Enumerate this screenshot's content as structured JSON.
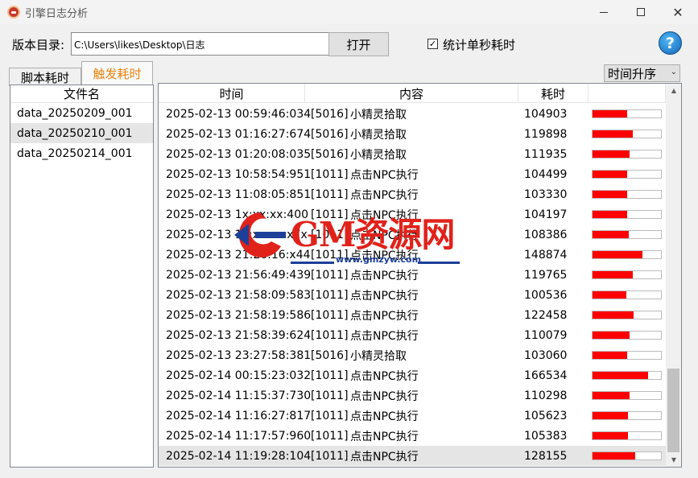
{
  "window": {
    "title": "引擎日志分析",
    "minimize_icon": "minimize-icon",
    "maximize_icon": "maximize-icon",
    "close_label": "✕"
  },
  "toolbar": {
    "dir_label": "版本目录:",
    "path_value": "C:\\Users\\likes\\Desktop\\日志",
    "open_label": "打开",
    "checkbox_checked": true,
    "checkbox_mark": "✓",
    "checkbox_label": "统计单秒耗时",
    "help_label": "?"
  },
  "tabs": [
    {
      "label": "脚本耗时",
      "active": false
    },
    {
      "label": "触发耗时",
      "active": true
    }
  ],
  "sort": {
    "selected": "时间升序"
  },
  "file_list": {
    "header": "文件名",
    "items": [
      {
        "name": "data_20250209_001",
        "selected": false
      },
      {
        "name": "data_20250210_001",
        "selected": true
      },
      {
        "name": "data_20250214_001",
        "selected": false
      }
    ]
  },
  "table": {
    "headers": [
      "时间",
      "内容",
      "耗时"
    ],
    "bar_max": 205000,
    "rows": [
      {
        "time": "2025-02-13 00:59:46:034",
        "code": "[5016]",
        "content": "小精灵拾取",
        "value": 104903
      },
      {
        "time": "2025-02-13 01:16:27:674",
        "code": "[5016]",
        "content": "小精灵拾取",
        "value": 119898
      },
      {
        "time": "2025-02-13 01:20:08:035",
        "code": "[5016]",
        "content": "小精灵拾取",
        "value": 111935
      },
      {
        "time": "2025-02-13 10:58:54:951",
        "code": "[1011]",
        "content": "点击NPC执行",
        "value": 104499
      },
      {
        "time": "2025-02-13 11:08:05:851",
        "code": "[1011]",
        "content": "点击NPC执行",
        "value": 103330
      },
      {
        "time": "2025-02-13 1x:xx:xx:400",
        "code": "[1011]",
        "content": "点击NPC执行",
        "value": 104197
      },
      {
        "time": "2025-02-13 1x:xx:xx:x7x",
        "code": "[1011]",
        "content": "点击NPC执行",
        "value": 108386
      },
      {
        "time": "2025-02-13 21:26:16:x44",
        "code": "[1011]",
        "content": "点击NPC执行",
        "value": 148874
      },
      {
        "time": "2025-02-13 21:56:49:439",
        "code": "[1011]",
        "content": "点击NPC执行",
        "value": 119765
      },
      {
        "time": "2025-02-13 21:58:09:583",
        "code": "[1011]",
        "content": "点击NPC执行",
        "value": 100536
      },
      {
        "time": "2025-02-13 21:58:19:586",
        "code": "[1011]",
        "content": "点击NPC执行",
        "value": 122458
      },
      {
        "time": "2025-02-13 21:58:39:624",
        "code": "[1011]",
        "content": "点击NPC执行",
        "value": 110079
      },
      {
        "time": "2025-02-13 23:27:58:381",
        "code": "[5016]",
        "content": "小精灵拾取",
        "value": 103060
      },
      {
        "time": "2025-02-14 00:15:23:032",
        "code": "[1011]",
        "content": "点击NPC执行",
        "value": 166534
      },
      {
        "time": "2025-02-14 11:15:37:730",
        "code": "[1011]",
        "content": "点击NPC执行",
        "value": 110298
      },
      {
        "time": "2025-02-14 11:16:27:817",
        "code": "[1011]",
        "content": "点击NPC执行",
        "value": 105623
      },
      {
        "time": "2025-02-14 11:17:57:960",
        "code": "[1011]",
        "content": "点击NPC执行",
        "value": 105383
      },
      {
        "time": "2025-02-14 11:19:28:104",
        "code": "[1011]",
        "content": "点击NPC执行",
        "value": 128155,
        "selected": true
      }
    ]
  },
  "scrollbar": {
    "up": "▲",
    "down": "▼"
  },
  "watermark": {
    "text": "GM资源网",
    "url": "www.gmzyw.com"
  },
  "colors": {
    "bar": "#ff0000",
    "active_tab_text": "#e8820e",
    "watermark_red": "#e0221b",
    "watermark_blue": "#1c3f98"
  }
}
